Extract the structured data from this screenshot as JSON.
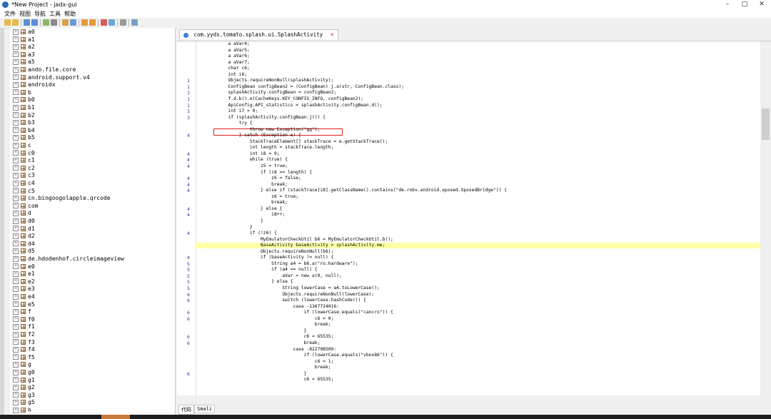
{
  "window": {
    "title": "*New Project - jadx-gui",
    "minimize": "–",
    "maximize": "□",
    "close": "✕"
  },
  "menu": [
    "文件",
    "视图",
    "导航",
    "工具",
    "帮助"
  ],
  "tree": {
    "items": [
      "a0",
      "a1",
      "a2",
      "a3",
      "a5",
      "ando.file.core",
      "android.support.v4",
      "androidx",
      "b",
      "b0",
      "b1",
      "b2",
      "b3",
      "b4",
      "b5",
      "c",
      "c0",
      "c1",
      "c2",
      "c3",
      "c4",
      "c5",
      "cn.bingoogolapple.qrcode",
      "com",
      "d",
      "d0",
      "d1",
      "d2",
      "d4",
      "d5",
      "de.hdodenhof.circleimageview",
      "e0",
      "e1",
      "e2",
      "e3",
      "e4",
      "e5",
      "f",
      "f0",
      "f1",
      "f2",
      "f3",
      "f4",
      "f5",
      "g",
      "g0",
      "g1",
      "g2",
      "g3",
      "g5",
      "h"
    ]
  },
  "editor": {
    "tab_title": "com.yyds.tomato.splash.ui.SplashActivity",
    "bottom_tabs": [
      "代码",
      "Smali"
    ],
    "gutter_numbers": [
      {
        "n": "1",
        "line": 6
      },
      {
        "n": "1",
        "line": 7
      },
      {
        "n": "1",
        "line": 8
      },
      {
        "n": "1",
        "line": 9
      },
      {
        "n": "1",
        "line": 10
      },
      {
        "n": "3",
        "line": 11
      },
      {
        "n": "3",
        "line": 12
      },
      {
        "n": "4",
        "line": 15
      },
      {
        "n": "4",
        "line": 18
      },
      {
        "n": "4",
        "line": 19
      },
      {
        "n": "4",
        "line": 20
      },
      {
        "n": "4",
        "line": 22
      },
      {
        "n": "4",
        "line": 23
      },
      {
        "n": "4",
        "line": 24
      },
      {
        "n": "4",
        "line": 27
      },
      {
        "n": "4",
        "line": 28
      },
      {
        "n": "4",
        "line": 31
      },
      {
        "n": "4",
        "line": 35
      },
      {
        "n": "5",
        "line": 36
      },
      {
        "n": "5",
        "line": 37
      },
      {
        "n": "5",
        "line": 38
      },
      {
        "n": "5",
        "line": 39
      },
      {
        "n": "5",
        "line": 40
      },
      {
        "n": "6",
        "line": 41
      },
      {
        "n": "6",
        "line": 42
      },
      {
        "n": "6",
        "line": 44
      },
      {
        "n": "6",
        "line": 45
      },
      {
        "n": "6",
        "line": 48
      },
      {
        "n": "6",
        "line": 49
      },
      {
        "n": "6",
        "line": 54
      },
      {
        "n": "6",
        "line": 59
      },
      {
        "n": "6",
        "line": 60
      },
      {
        "n": "6",
        "line": 64
      }
    ],
    "code_lines": [
      "            a aVar4;",
      "            a aVar5;",
      "            a aVar6;",
      "            a aVar7;",
      "            char c6;",
      "            int i6;",
      "            Objects.requireNonNull(splashActivity);",
      "            ConfigBean configBean2 = (ConfigBean) j.a(str, ConfigBean.class);",
      "            splashActivity.configBean = configBean2;",
      "            f.d.b().e(CacheKeys.KEY_CONFIG_INFO, configBean2);",
      "            ApiConfig.API_statistics = splashActivity.configBean.d();",
      "            int i7 = 0;",
      "            if (splashActivity.configBean.j()) {",
      "                try {",
      "                    throw new Exception(\"gg\");",
      "                } catch (Exception e) {",
      "                    StackTraceElement[] stackTrace = e.getStackTrace();",
      "                    int length = stackTrace.length;",
      "                    int i8 = 0;",
      "                    while (true) {",
      "                        z5 = true;",
      "                        if (i8 >= length) {",
      "                            z6 = false;",
      "                            break;",
      "                        } else if (stackTrace[i8].getClassName().contains(\"de.robv.android.xposed.XposedBridge\")) {",
      "                            z6 = true;",
      "                            break;",
      "                        } else {",
      "                            i8++;",
      "                        }",
      "                    }",
      "                    if (!z6) {",
      "                        MyEmulatorCheckUtil b6 = MyEmulatorCheckUtil.b();",
      "                        BaseActivity baseActivity = splashActivity.me;",
      "                        Objects.requireNonNull(b6);",
      "                        if (baseActivity != null) {",
      "                            String a4 = b6.a(\"ro.hardware\");",
      "                            if (a4 == null) {",
      "                                aVar = new a(0, null);",
      "                            } else {",
      "                                String lowerCase = a4.toLowerCase();",
      "                                Objects.requireNonNull(lowerCase);",
      "                                switch (lowerCase.hashCode()) {",
      "                                    case -1367724016:",
      "                                        if (lowerCase.equals(\"cancro\")) {",
      "                                            c6 = 0;",
      "                                            break;",
      "                                        }",
      "                                        c6 = 65535;",
      "                                        break;",
      "                                    case -822798509:",
      "                                        if (lowerCase.equals(\"vbox86\")) {",
      "                                            c6 = 1;",
      "                                            break;",
      "                                        }",
      "                                        c6 = 65535;"
    ]
  },
  "colors": {
    "highlight": "#ffffa8",
    "annotation_box": "#e02020",
    "line_numbers": "#3333aa"
  }
}
